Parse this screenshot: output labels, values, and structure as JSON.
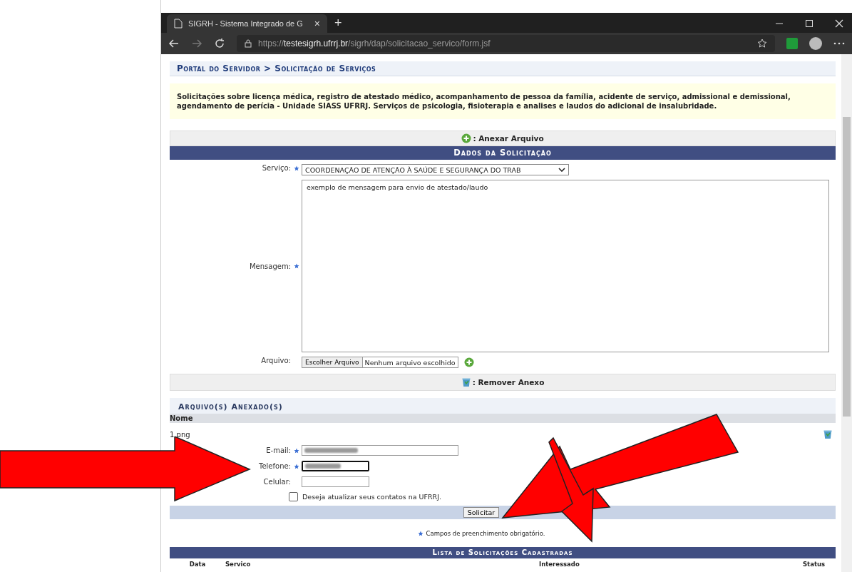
{
  "browser": {
    "tab": {
      "title": "SIGRH - Sistema Integrado de G",
      "close": "×"
    },
    "new_tab": "+",
    "address": {
      "scheme": "https://",
      "host": "testesigrh.ufrrj.br",
      "path": "/sigrh/dap/solicitacao_servico/form.jsf"
    }
  },
  "breadcrumb": "Portal do Servidor > Solicitação de Serviços",
  "intro": "Solicitações sobre licença médica, registro de atestado médico, acompanhamento de pessoa da família, acidente de serviço, admissional e demissional, agendamento de perícia - Unidade SIASS UFRRJ. Serviços de psicologia, fisioterapia e analises e laudos do adicional de insalubridade.",
  "attach_bar": ": Anexar Arquivo",
  "form": {
    "title": "Dados da Solicitação",
    "service": {
      "label": "Serviço:",
      "required": true,
      "value": "COORDENAÇÃO DE ATENÇÃO À SAÚDE E SEGURANÇA DO TRAB"
    },
    "message": {
      "label": "Mensagem:",
      "required": true,
      "value": "exemplo de mensagem para envio de atestado/laudo"
    },
    "file": {
      "label": "Arquivo:",
      "button": "Escolher Arquivo",
      "status": "Nenhum arquivo escolhido"
    }
  },
  "remove_bar": ": Remover Anexo",
  "attached": {
    "title": "Arquivo(s) Anexado(s)",
    "columns": [
      "Nome"
    ],
    "rows": [
      {
        "name": "1.png"
      }
    ]
  },
  "contacts": [
    {
      "kind": "email",
      "label": "E-mail:",
      "required": true,
      "redacted": true,
      "focused": false
    },
    {
      "kind": "phone",
      "label": "Telefone:",
      "required": true,
      "redacted": true,
      "focused": true
    },
    {
      "kind": "mobile",
      "label": "Celular:",
      "required": false,
      "redacted": false,
      "focused": false
    }
  ],
  "update_contacts": {
    "label": "Deseja atualizar seus contatos na UFRRJ.",
    "checked": false
  },
  "submit": "Solicitar",
  "required_note": "Campos de preenchimento obrigatório.",
  "list": {
    "title": "Lista de Solicitações Cadastradas",
    "columns": [
      "Data",
      "Servico",
      "Interessado",
      "Status"
    ]
  }
}
